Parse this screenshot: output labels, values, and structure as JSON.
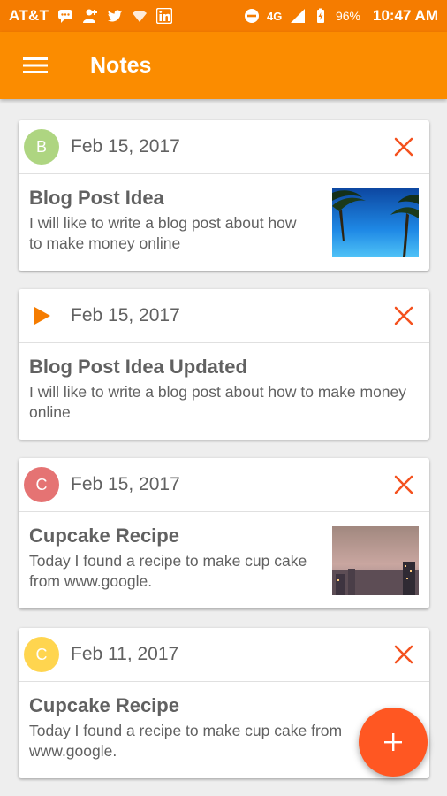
{
  "status_bar": {
    "carrier": "AT&T",
    "battery": "96%",
    "time": "10:47 AM",
    "icons": [
      "chat-icon",
      "person-add-icon",
      "twitter-icon",
      "wifi-icon",
      "linkedin-icon",
      "do-not-disturb-icon",
      "4g-icon",
      "signal-icon",
      "battery-icon"
    ]
  },
  "app_bar": {
    "title": "Notes",
    "menu_icon": "hamburger-menu-icon"
  },
  "notes": [
    {
      "avatar": "B",
      "avatar_color": "#aed581",
      "date": "Feb 15, 2017",
      "title": "Blog Post Idea",
      "text": "I will like to write a blog post about how to make money online",
      "has_image": true
    },
    {
      "avatar_icon": "play-icon",
      "avatar_color": "#f57c00",
      "date": "Feb 15, 2017",
      "title": "Blog Post Idea Updated",
      "text": "I will like to write a blog post about how to make money online",
      "has_image": false
    },
    {
      "avatar": "C",
      "avatar_color": "#e57373",
      "date": "Feb 15, 2017",
      "title": "Cupcake Recipe",
      "text": "Today I found a recipe to make cup cake from www.google.",
      "has_image": true
    },
    {
      "avatar": "C",
      "avatar_color": "#ffd54f",
      "date": "Feb 11, 2017",
      "title": "Cupcake Recipe",
      "text": "Today I found a recipe to make cup cake from www.google.",
      "has_image": false
    }
  ],
  "colors": {
    "primary": "#fb8c00",
    "primary_dark": "#f57c00",
    "accent": "#ff5722",
    "delete": "#f4511e"
  },
  "fab": {
    "icon": "plus-icon"
  }
}
